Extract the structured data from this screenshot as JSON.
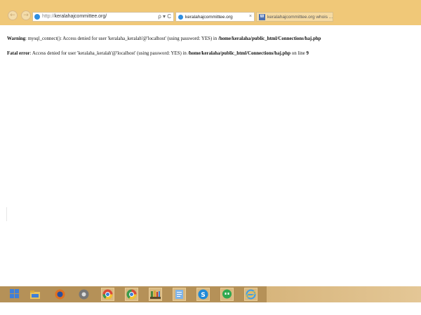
{
  "browser": {
    "address": {
      "protocol": "http://",
      "domain": "keralahajcommittee.org/"
    },
    "address_icons": "ρ ▾ C",
    "tabs": [
      {
        "label": "keralahajcommittee.org",
        "close": "×"
      },
      {
        "label": "keralahajcommittee.org whois ..."
      }
    ]
  },
  "page": {
    "warning": {
      "label": "Warning",
      "text": ": mysql_connect(): Access denied for user 'keralaha_keralah'@'localhost' (using password: YES) in ",
      "path": "/home/keralaha/public_html/Connections/haj.php"
    },
    "fatal": {
      "label": "Fatal error",
      "text": ": Access denied for user 'keralaha_keralah'@'localhost' (using password: YES) in ",
      "path": "/home/keralaha/public_html/Connections/haj.php",
      "line_text": " on line ",
      "line_no": "9"
    }
  },
  "taskbar": {
    "icons": [
      "windows-start-icon",
      "file-explorer-icon",
      "firefox-icon",
      "chrome-icon",
      "chrome-icon",
      "chrome-icon",
      "bookshelf-icon",
      "notepad-icon",
      "skype-icon",
      "hangouts-icon",
      "internet-explorer-icon"
    ]
  }
}
